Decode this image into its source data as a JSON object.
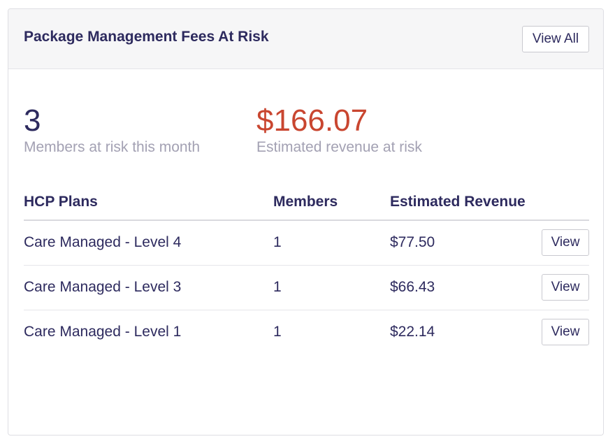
{
  "header": {
    "title": "Package Management Fees At Risk",
    "view_all_label": "View All"
  },
  "stats": {
    "members_value": "3",
    "members_label": "Members at risk this month",
    "revenue_value": "$166.07",
    "revenue_label": "Estimated revenue at risk"
  },
  "table": {
    "headers": [
      "HCP Plans",
      "Members",
      "Estimated Revenue"
    ],
    "rows": [
      {
        "plan": "Care Managed - Level 4",
        "members": "1",
        "revenue": "$77.50",
        "action": "View"
      },
      {
        "plan": "Care Managed - Level 3",
        "members": "1",
        "revenue": "$66.43",
        "action": "View"
      },
      {
        "plan": "Care Managed - Level 1",
        "members": "1",
        "revenue": "$22.14",
        "action": "View"
      }
    ]
  },
  "colors": {
    "primary_text": "#2d2a5e",
    "revenue_accent": "#c94630",
    "muted_text": "#a3a1b3",
    "header_bg": "#f6f6f7"
  }
}
